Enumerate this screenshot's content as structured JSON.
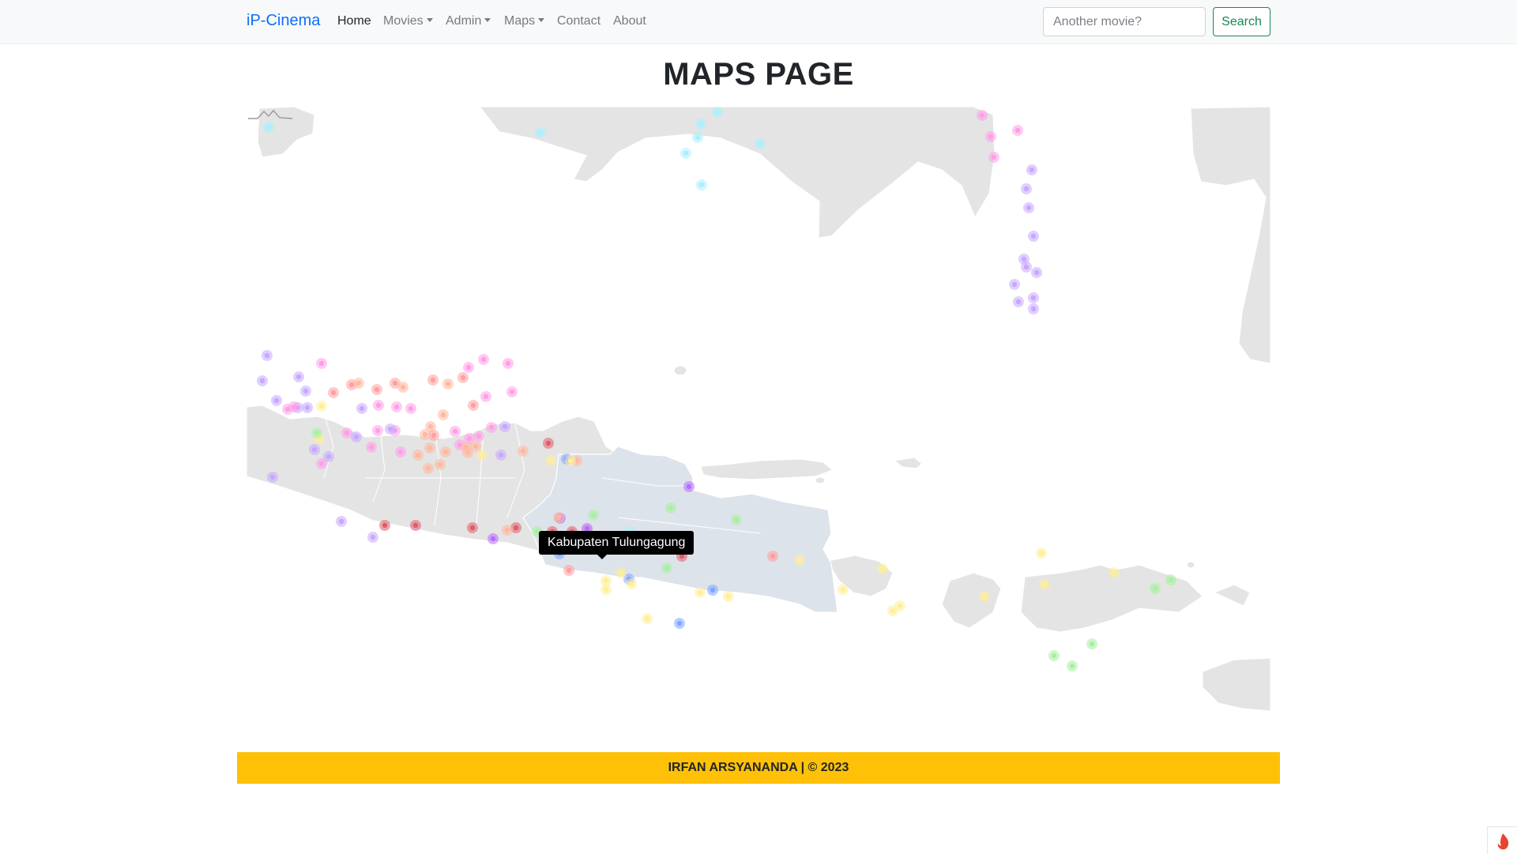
{
  "navbar": {
    "brand": "iP-Cinema",
    "items": [
      {
        "label": "Home",
        "dropdown": false,
        "active": true
      },
      {
        "label": "Movies",
        "dropdown": true,
        "active": false
      },
      {
        "label": "Admin",
        "dropdown": true,
        "active": false
      },
      {
        "label": "Maps",
        "dropdown": true,
        "active": false
      },
      {
        "label": "Contact",
        "dropdown": false,
        "active": false
      },
      {
        "label": "About",
        "dropdown": false,
        "active": false
      }
    ],
    "search": {
      "placeholder": "Another movie?",
      "value": "",
      "button_label": "Search"
    }
  },
  "page": {
    "title": "MAPS PAGE"
  },
  "map": {
    "tooltip": "Kabupaten Tulungagung",
    "land_color": "#e4e4e4",
    "highlight_color": "#dde3ea",
    "border_color": "#ffffff",
    "marker_colors": [
      "#ff9ee8",
      "#c6a8ff",
      "#ff9f9f",
      "#ffb8a0",
      "#a8f0ff",
      "#ffee99",
      "#a8f0a0",
      "#7ea6ff",
      "#e05c6a",
      "#b86cff"
    ]
  },
  "footer": {
    "text": "IRFAN ARSYANANDA | © 2023",
    "color": "#ffc107"
  },
  "corner_icon": {
    "icon": "flame-icon",
    "color": "#e8432e"
  }
}
